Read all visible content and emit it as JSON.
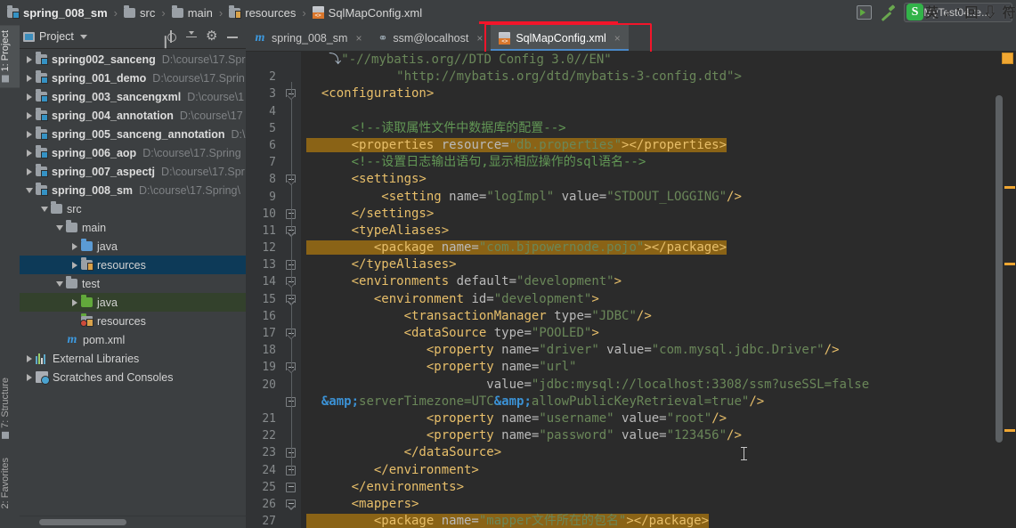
{
  "window": {
    "breadcrumb": [
      {
        "label": "spring_008_sm",
        "icon": "module-folder-icon",
        "bold": true
      },
      {
        "label": "src",
        "icon": "folder-icon",
        "bold": false
      },
      {
        "label": "main",
        "icon": "folder-icon",
        "bold": false
      },
      {
        "label": "resources",
        "icon": "resources-folder-icon",
        "bold": false
      },
      {
        "label": "SqlMapConfig.xml",
        "icon": "xml-file-icon",
        "bold": false
      }
    ],
    "separator": "›",
    "run_config": "MyTest04.te...",
    "run_button": "run-icon",
    "build_button": "build-hammer-icon"
  },
  "ime_overlay": {
    "logo": "S",
    "glyphs": "英 ♪ ’ 回 ⇩ 符"
  },
  "left_tool_strip": [
    {
      "label": "1: Project",
      "selected": true
    },
    {
      "label": "7: Structure",
      "selected": false
    },
    {
      "label": "2: Favorites",
      "selected": false
    }
  ],
  "project_panel": {
    "title": "Project",
    "header_icons": [
      "locate-icon",
      "collapse-all-icon",
      "gear-icon",
      "minimize-icon"
    ],
    "tree": [
      {
        "indent": 0,
        "arrow": "right",
        "icon": "module-folder-icon",
        "name": "spring002_sanceng",
        "path": "D:\\course\\17.Spr",
        "bold": true,
        "state": "none"
      },
      {
        "indent": 0,
        "arrow": "right",
        "icon": "module-folder-icon",
        "name": "spring_001_demo",
        "path": "D:\\course\\17.Sprin",
        "bold": true,
        "state": "none"
      },
      {
        "indent": 0,
        "arrow": "right",
        "icon": "module-folder-icon",
        "name": "spring_003_sancengxml",
        "path": "D:\\course\\1",
        "bold": true,
        "state": "none"
      },
      {
        "indent": 0,
        "arrow": "right",
        "icon": "module-folder-icon",
        "name": "spring_004_annotation",
        "path": "D:\\course\\17",
        "bold": true,
        "state": "none"
      },
      {
        "indent": 0,
        "arrow": "right",
        "icon": "module-folder-icon",
        "name": "spring_005_sanceng_annotation",
        "path": "D:\\",
        "bold": true,
        "state": "none"
      },
      {
        "indent": 0,
        "arrow": "right",
        "icon": "module-folder-icon",
        "name": "spring_006_aop",
        "path": "D:\\course\\17.Spring",
        "bold": true,
        "state": "none"
      },
      {
        "indent": 0,
        "arrow": "right",
        "icon": "module-folder-icon",
        "name": "spring_007_aspectj",
        "path": "D:\\course\\17.Spr",
        "bold": true,
        "state": "none"
      },
      {
        "indent": 0,
        "arrow": "down",
        "icon": "module-folder-icon",
        "name": "spring_008_sm",
        "path": "D:\\course\\17.Spring\\",
        "bold": true,
        "state": "none"
      },
      {
        "indent": 1,
        "arrow": "down",
        "icon": "folder-icon",
        "name": "src",
        "path": "",
        "bold": false,
        "state": "none"
      },
      {
        "indent": 2,
        "arrow": "down",
        "icon": "folder-icon",
        "name": "main",
        "path": "",
        "bold": false,
        "state": "none"
      },
      {
        "indent": 3,
        "arrow": "right",
        "icon": "source-folder-icon",
        "name": "java",
        "path": "",
        "bold": false,
        "state": "none"
      },
      {
        "indent": 3,
        "arrow": "right",
        "icon": "resources-folder-icon",
        "name": "resources",
        "path": "",
        "bold": false,
        "state": "selected-blue"
      },
      {
        "indent": 2,
        "arrow": "down",
        "icon": "folder-icon",
        "name": "test",
        "path": "",
        "bold": false,
        "state": "none"
      },
      {
        "indent": 3,
        "arrow": "right",
        "icon": "test-source-folder-icon",
        "name": "java",
        "path": "",
        "bold": false,
        "state": "selected-green"
      },
      {
        "indent": 3,
        "arrow": "none",
        "icon": "test-resources-folder-icon",
        "name": "resources",
        "path": "",
        "bold": false,
        "state": "none"
      },
      {
        "indent": 2,
        "arrow": "none",
        "icon": "maven-file-icon",
        "name": "pom.xml",
        "path": "",
        "bold": false,
        "state": "none"
      },
      {
        "indent": 0,
        "arrow": "right",
        "icon": "libraries-icon",
        "name": "External Libraries",
        "path": "",
        "bold": false,
        "state": "none"
      },
      {
        "indent": 0,
        "arrow": "right",
        "icon": "scratches-icon",
        "name": "Scratches and Consoles",
        "path": "",
        "bold": false,
        "state": "none"
      }
    ]
  },
  "editor": {
    "tabs": [
      {
        "label": "spring_008_sm",
        "icon": "maven-file-icon",
        "active": false,
        "close": "×"
      },
      {
        "label": "ssm@localhost",
        "icon": "database-icon",
        "active": false,
        "close": "×"
      },
      {
        "label": "SqlMapConfig.xml",
        "icon": "xml-file-icon",
        "active": true,
        "close": "×"
      }
    ],
    "annotation_color": "#f3152a",
    "first_visible_line_number": 2,
    "lines": [
      {
        "num": "",
        "fold": "none",
        "segments": [
          {
            "t": "   ",
            "c": "punct"
          },
          {
            "t": "⤵",
            "c": "punct"
          },
          {
            "t": "\"-//mybatis.org//DTD Config 3.0//EN\"",
            "c": "str"
          }
        ]
      },
      {
        "num": "2",
        "fold": "none",
        "segments": [
          {
            "t": "            ",
            "c": "punct"
          },
          {
            "t": "\"http://mybatis.org/dtd/mybatis-3-config.dtd\">",
            "c": "str"
          }
        ]
      },
      {
        "num": "3",
        "fold": "open",
        "segments": [
          {
            "t": "  ",
            "c": "punct"
          },
          {
            "t": "<configuration>",
            "c": "tag"
          }
        ]
      },
      {
        "num": "4",
        "fold": "none",
        "segments": []
      },
      {
        "num": "5",
        "fold": "none",
        "segments": [
          {
            "t": "      ",
            "c": "punct"
          },
          {
            "t": "<!--读取属性文件中数据库的配置-->",
            "c": "cmt"
          }
        ]
      },
      {
        "num": "6",
        "fold": "none",
        "highlight": true,
        "segments": [
          {
            "t": "      ",
            "c": "punct"
          },
          {
            "t": "<properties ",
            "c": "tag"
          },
          {
            "t": "resource=",
            "c": "attr"
          },
          {
            "t": "\"db.properties\"",
            "c": "str"
          },
          {
            "t": "></properties>",
            "c": "tag"
          }
        ]
      },
      {
        "num": "7",
        "fold": "none",
        "segments": [
          {
            "t": "      ",
            "c": "punct"
          },
          {
            "t": "<!--设置日志输出语句,显示相应操作的sql语名--> ",
            "c": "cmt"
          }
        ]
      },
      {
        "num": "8",
        "fold": "open",
        "segments": [
          {
            "t": "      ",
            "c": "punct"
          },
          {
            "t": "<settings>",
            "c": "tag"
          }
        ]
      },
      {
        "num": "9",
        "fold": "none",
        "segments": [
          {
            "t": "          ",
            "c": "punct"
          },
          {
            "t": "<setting ",
            "c": "tag"
          },
          {
            "t": "name=",
            "c": "attr"
          },
          {
            "t": "\"logImpl\" ",
            "c": "str"
          },
          {
            "t": "value=",
            "c": "attr"
          },
          {
            "t": "\"STDOUT_LOGGING\"",
            "c": "str"
          },
          {
            "t": "/>",
            "c": "tag"
          }
        ]
      },
      {
        "num": "10",
        "fold": "close",
        "segments": [
          {
            "t": "      ",
            "c": "punct"
          },
          {
            "t": "</settings>",
            "c": "tag"
          }
        ]
      },
      {
        "num": "11",
        "fold": "open",
        "segments": [
          {
            "t": "      ",
            "c": "punct"
          },
          {
            "t": "<typeAliases>",
            "c": "tag"
          }
        ]
      },
      {
        "num": "12",
        "fold": "none",
        "highlight": true,
        "segments": [
          {
            "t": "         ",
            "c": "punct"
          },
          {
            "t": "<package ",
            "c": "tag"
          },
          {
            "t": "name=",
            "c": "attr"
          },
          {
            "t": "\"com.bjpowernode.pojo\"",
            "c": "str"
          },
          {
            "t": "></package>",
            "c": "tag"
          }
        ]
      },
      {
        "num": "13",
        "fold": "close",
        "segments": [
          {
            "t": "      ",
            "c": "punct"
          },
          {
            "t": "</typeAliases>",
            "c": "tag"
          }
        ]
      },
      {
        "num": "14",
        "fold": "open",
        "segments": [
          {
            "t": "      ",
            "c": "punct"
          },
          {
            "t": "<environments ",
            "c": "tag"
          },
          {
            "t": "default=",
            "c": "attr"
          },
          {
            "t": "\"development\"",
            "c": "str"
          },
          {
            "t": ">",
            "c": "tag"
          }
        ]
      },
      {
        "num": "15",
        "fold": "open",
        "segments": [
          {
            "t": "         ",
            "c": "punct"
          },
          {
            "t": "<environment ",
            "c": "tag"
          },
          {
            "t": "id=",
            "c": "attr"
          },
          {
            "t": "\"development\"",
            "c": "str"
          },
          {
            "t": ">",
            "c": "tag"
          }
        ]
      },
      {
        "num": "16",
        "fold": "none",
        "segments": [
          {
            "t": "             ",
            "c": "punct"
          },
          {
            "t": "<transactionManager ",
            "c": "tag"
          },
          {
            "t": "type=",
            "c": "attr"
          },
          {
            "t": "\"JDBC\"",
            "c": "str"
          },
          {
            "t": "/>",
            "c": "tag"
          }
        ]
      },
      {
        "num": "17",
        "fold": "open",
        "segments": [
          {
            "t": "             ",
            "c": "punct"
          },
          {
            "t": "<dataSource ",
            "c": "tag"
          },
          {
            "t": "type=",
            "c": "attr"
          },
          {
            "t": "\"POOLED\"",
            "c": "str"
          },
          {
            "t": ">",
            "c": "tag"
          }
        ]
      },
      {
        "num": "18",
        "fold": "none",
        "segments": [
          {
            "t": "                ",
            "c": "punct"
          },
          {
            "t": "<property ",
            "c": "tag"
          },
          {
            "t": "name=",
            "c": "attr"
          },
          {
            "t": "\"driver\" ",
            "c": "str"
          },
          {
            "t": "value=",
            "c": "attr"
          },
          {
            "t": "\"com.mysql.jdbc.Driver\"",
            "c": "str"
          },
          {
            "t": "/>",
            "c": "tag"
          }
        ]
      },
      {
        "num": "19",
        "fold": "open",
        "segments": [
          {
            "t": "                ",
            "c": "punct"
          },
          {
            "t": "<property ",
            "c": "tag"
          },
          {
            "t": "name=",
            "c": "attr"
          },
          {
            "t": "\"url\"",
            "c": "str"
          }
        ]
      },
      {
        "num": "20",
        "fold": "none",
        "segments": [
          {
            "t": "                        ",
            "c": "punct"
          },
          {
            "t": "value=",
            "c": "attr"
          },
          {
            "t": "\"jdbc:mysql://localhost:3308/ssm?useSSL=false",
            "c": "str"
          }
        ]
      },
      {
        "num": "",
        "fold": "close",
        "segments": [
          {
            "t": "  ",
            "c": "punct"
          },
          {
            "t": "&amp;",
            "c": "ent"
          },
          {
            "t": "serverTimezone=UTC",
            "c": "str"
          },
          {
            "t": "&amp;",
            "c": "ent"
          },
          {
            "t": "allowPublicKeyRetrieval=true\"",
            "c": "str"
          },
          {
            "t": "/>",
            "c": "tag"
          }
        ]
      },
      {
        "num": "21",
        "fold": "none",
        "segments": [
          {
            "t": "                ",
            "c": "punct"
          },
          {
            "t": "<property ",
            "c": "tag"
          },
          {
            "t": "name=",
            "c": "attr"
          },
          {
            "t": "\"username\" ",
            "c": "str"
          },
          {
            "t": "value=",
            "c": "attr"
          },
          {
            "t": "\"root\"",
            "c": "str"
          },
          {
            "t": "/>",
            "c": "tag"
          }
        ]
      },
      {
        "num": "22",
        "fold": "none",
        "segments": [
          {
            "t": "                ",
            "c": "punct"
          },
          {
            "t": "<property ",
            "c": "tag"
          },
          {
            "t": "name=",
            "c": "attr"
          },
          {
            "t": "\"password\" ",
            "c": "str"
          },
          {
            "t": "value=",
            "c": "attr"
          },
          {
            "t": "\"123456\"",
            "c": "str"
          },
          {
            "t": "/>",
            "c": "tag"
          }
        ]
      },
      {
        "num": "23",
        "fold": "close",
        "segments": [
          {
            "t": "             ",
            "c": "punct"
          },
          {
            "t": "</dataSource>",
            "c": "tag"
          }
        ]
      },
      {
        "num": "24",
        "fold": "close",
        "segments": [
          {
            "t": "         ",
            "c": "punct"
          },
          {
            "t": "</environment>",
            "c": "tag"
          }
        ]
      },
      {
        "num": "25",
        "fold": "close",
        "segments": [
          {
            "t": "      ",
            "c": "punct"
          },
          {
            "t": "</environments>",
            "c": "tag"
          }
        ]
      },
      {
        "num": "26",
        "fold": "open",
        "segments": [
          {
            "t": "      ",
            "c": "punct"
          },
          {
            "t": "<mappers>",
            "c": "tag"
          }
        ]
      },
      {
        "num": "27",
        "fold": "none",
        "highlight": true,
        "segments": [
          {
            "t": "         ",
            "c": "punct"
          },
          {
            "t": "<package ",
            "c": "tag"
          },
          {
            "t": "name=",
            "c": "attr"
          },
          {
            "t": "\"mapper文件所在的包名\"",
            "c": "str"
          },
          {
            "t": "></package>",
            "c": "tag"
          }
        ]
      }
    ],
    "markers": {
      "warning_square": "warning-indicator",
      "stripe_positions": [
        152,
        238,
        425
      ]
    }
  }
}
